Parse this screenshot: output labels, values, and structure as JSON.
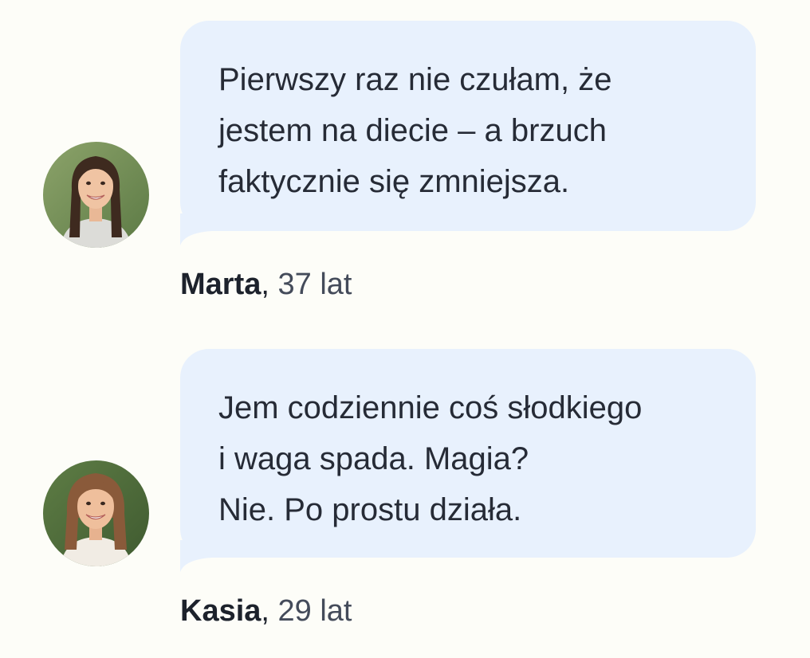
{
  "testimonials": [
    {
      "avatar_icon": "woman-portrait-avatar",
      "lines": [
        "Pierwszy raz nie czułam, że",
        "jestem na diecie – a brzuch",
        "faktycznie się zmniejsza."
      ],
      "name": "Marta",
      "separator": ",",
      "age": "37 lat"
    },
    {
      "avatar_icon": "woman-portrait-avatar",
      "lines": [
        "Jem codziennie coś słodkiego",
        "i waga spada. Magia?",
        "Nie. Po prostu działa."
      ],
      "name": "Kasia",
      "separator": ",",
      "age": "29 lat"
    }
  ],
  "colors": {
    "background": "#fdfdf8",
    "bubble": "#e8f1fd",
    "text": "#262b36",
    "name": "#1d222c",
    "age": "#444b5a"
  }
}
